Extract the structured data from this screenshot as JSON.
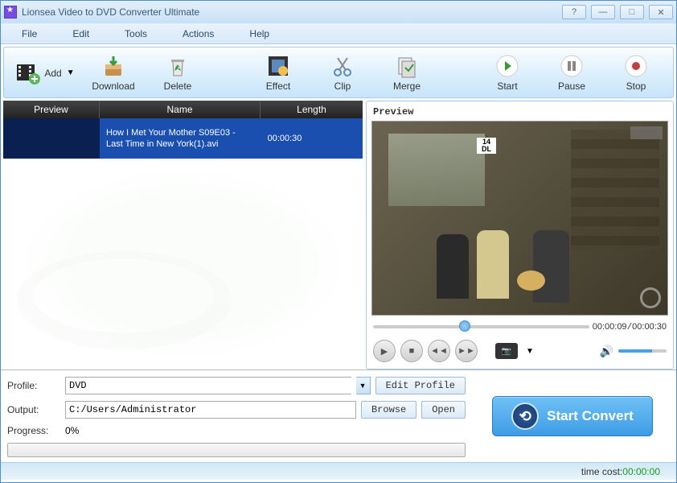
{
  "window": {
    "title": "Lionsea Video to DVD Converter Ultimate"
  },
  "menu": {
    "file": "File",
    "edit": "Edit",
    "tools": "Tools",
    "actions": "Actions",
    "help": "Help"
  },
  "toolbar": {
    "add": "Add",
    "download": "Download",
    "delete": "Delete",
    "effect": "Effect",
    "clip": "Clip",
    "merge": "Merge",
    "start": "Start",
    "pause": "Pause",
    "stop": "Stop"
  },
  "list": {
    "headers": {
      "preview": "Preview",
      "name": "Name",
      "length": "Length"
    },
    "rows": [
      {
        "name": "How I Met Your Mother S09E03 - Last Time in New York(1).avi",
        "length": "00:00:30"
      }
    ]
  },
  "preview": {
    "title": "Preview",
    "rating": "14\nDL",
    "time_current": "00:00:09",
    "time_total": "00:00:30"
  },
  "settings": {
    "profile_label": "Profile:",
    "profile_value": "DVD",
    "edit_profile": "Edit Profile",
    "output_label": "Output:",
    "output_value": "C:/Users/Administrator",
    "browse": "Browse",
    "open": "Open",
    "progress_label": "Progress:",
    "progress_value": "0%"
  },
  "convert_button": "Start Convert",
  "status": {
    "time_cost_label": "time cost:",
    "time_cost_value": "00:00:00"
  }
}
